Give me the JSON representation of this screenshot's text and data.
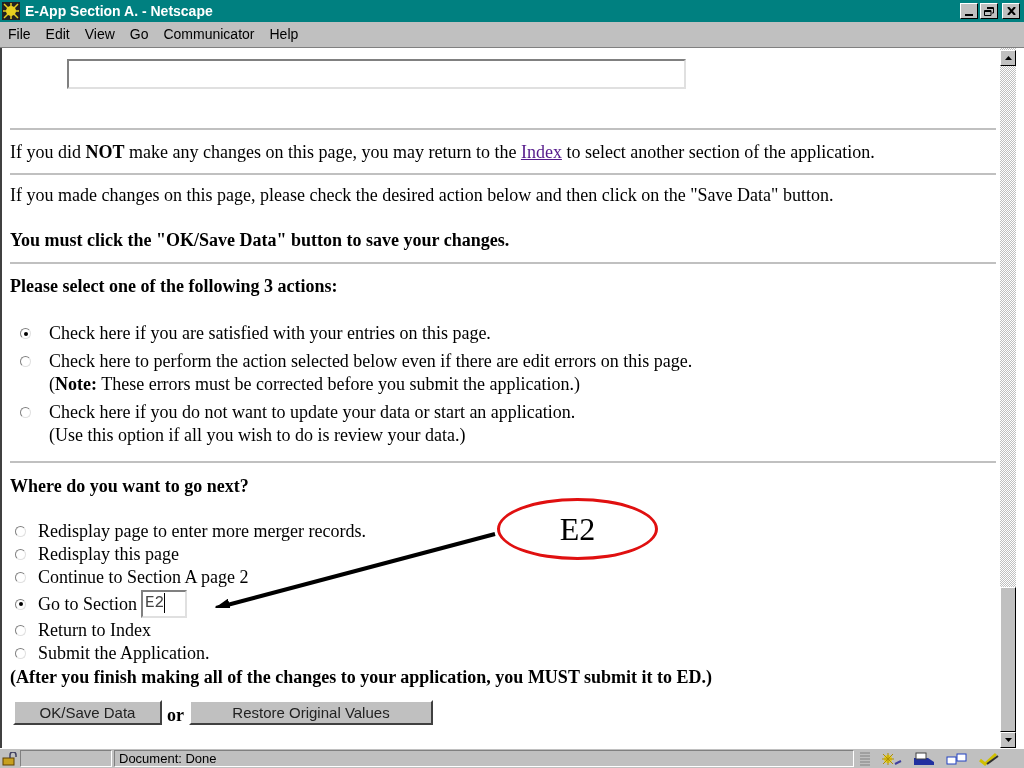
{
  "window": {
    "title": "E-App Section A. - Netscape"
  },
  "menu": [
    "File",
    "Edit",
    "View",
    "Go",
    "Communicator",
    "Help"
  ],
  "index_note": {
    "before": "If you did **NOT** make any changes on this page, you may return to the",
    "link": "Index",
    "after": "to select another section of the application."
  },
  "instructions": [
    "If you made changes on this page, please check the desired action below and then click on the \"Save Data\" button."
  ],
  "warning": "You must click the \"OK/Save Data\" button to save your changes.",
  "actions": {
    "heading": "Please select one of the following 3 actions:",
    "options": [
      {
        "lines": [
          "Check here if you are satisfied with your entries on this page."
        ],
        "selected": true
      },
      {
        "lines": [
          "Check here to perform the action selected below even if there are edit errors on this page.",
          "(**Note:** These errors must be corrected before you submit the application.)"
        ],
        "selected": false
      },
      {
        "lines": [
          "Check here if you do not want to update your data or start an application.",
          "(Use this option if all you wish to do is review your data.)"
        ],
        "selected": false
      }
    ]
  },
  "next": {
    "heading": "Where do you want to go next?",
    "options": [
      {
        "kind": "plain",
        "label": "Redisplay page to enter more merger records.",
        "selected": false
      },
      {
        "kind": "plain",
        "label": "Redisplay this page",
        "selected": false
      },
      {
        "kind": "plain",
        "label": "Continue to Section A page 2",
        "selected": false
      },
      {
        "kind": "field",
        "label": "Go to Section",
        "value": "E2",
        "selected": true
      },
      {
        "kind": "plain",
        "label": "Return to Index",
        "selected": false
      },
      {
        "kind": "plain",
        "label": "Submit the Application.",
        "selected": false
      }
    ],
    "footnote": "(After you finish making all of the changes to your application, you MUST submit it to ED.)"
  },
  "annotation": {
    "label": "E2"
  },
  "buttons": {
    "save": "OK/Save Data",
    "separator": "or",
    "restore": "Restore Original Values"
  },
  "status_bar": {
    "text": "Document: Done"
  }
}
